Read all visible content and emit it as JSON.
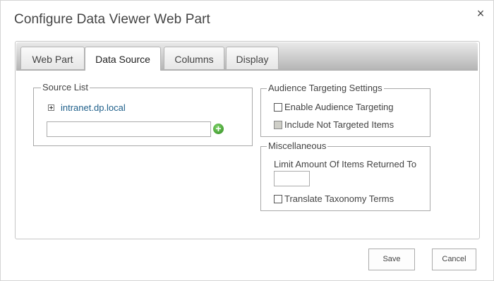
{
  "dialog": {
    "title": "Configure Data Viewer Web Part",
    "close_icon": "×"
  },
  "tabs": [
    {
      "label": "Web Part",
      "active": false
    },
    {
      "label": "Data Source",
      "active": true
    },
    {
      "label": "Columns",
      "active": false
    },
    {
      "label": "Display",
      "active": false
    }
  ],
  "source_list": {
    "legend": "Source List",
    "tree_node": "intranet.dp.local",
    "expand_icon": "plus-square-icon",
    "input_value": "",
    "add_icon": "add-circle-icon"
  },
  "audience_targeting": {
    "legend": "Audience Targeting Settings",
    "enable_label": "Enable Audience Targeting",
    "enable_checked": false,
    "include_label": "Include Not Targeted Items",
    "include_checked": false,
    "include_disabled": true
  },
  "miscellaneous": {
    "legend": "Miscellaneous",
    "limit_label": "Limit Amount Of Items Returned To",
    "limit_value": "",
    "translate_label": "Translate Taxonomy Terms",
    "translate_checked": false
  },
  "buttons": {
    "save": "Save",
    "cancel": "Cancel"
  },
  "colors": {
    "link": "#1e5f8a",
    "add_icon": "#3a9a26"
  }
}
